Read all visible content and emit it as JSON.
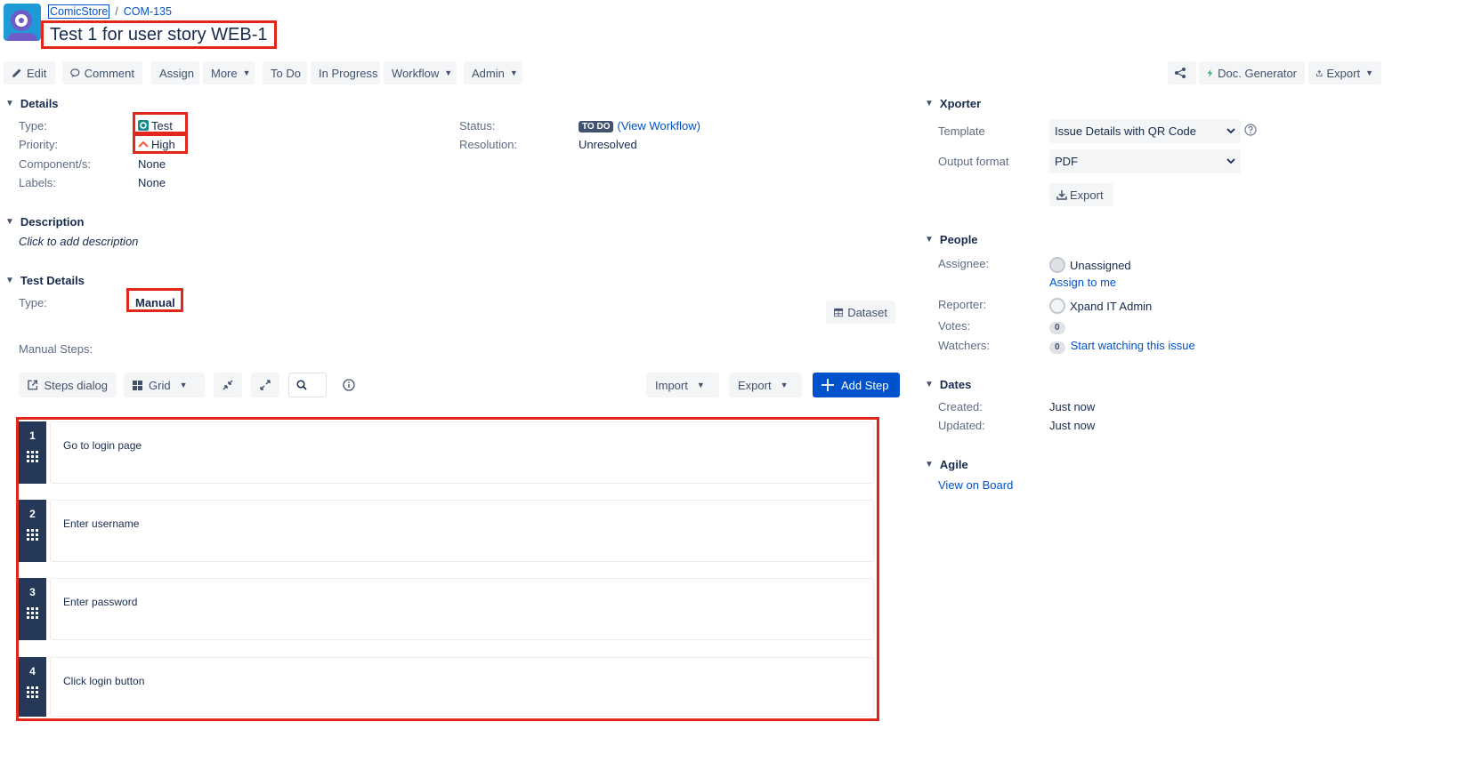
{
  "breadcrumb": {
    "project": "ComicStore",
    "separator": "/",
    "issue_key": "COM-135"
  },
  "issue_title": "Test 1 for user story WEB-1",
  "toolbar": {
    "edit": "Edit",
    "comment": "Comment",
    "assign": "Assign",
    "more": "More",
    "todo": "To Do",
    "in_progress": "In Progress",
    "workflow": "Workflow",
    "admin": "Admin",
    "doc_generator": "Doc. Generator",
    "export": "Export"
  },
  "details": {
    "header": "Details",
    "type_label": "Type:",
    "type_value": "Test",
    "priority_label": "Priority:",
    "priority_value": "High",
    "components_label": "Component/s:",
    "components_value": "None",
    "labels_label": "Labels:",
    "labels_value": "None",
    "status_label": "Status:",
    "status_value": "TO DO",
    "view_workflow": "(View Workflow)",
    "resolution_label": "Resolution:",
    "resolution_value": "Unresolved"
  },
  "description": {
    "header": "Description",
    "placeholder": "Click to add description"
  },
  "test_details": {
    "header": "Test Details",
    "type_label": "Type:",
    "type_value": "Manual",
    "dataset": "Dataset",
    "manual_steps_label": "Manual Steps:"
  },
  "steps_toolbar": {
    "steps_dialog": "Steps dialog",
    "grid": "Grid",
    "import": "Import",
    "export": "Export",
    "add_step": "Add Step"
  },
  "steps": [
    {
      "number": "1",
      "action": "Go to login page"
    },
    {
      "number": "2",
      "action": "Enter username"
    },
    {
      "number": "3",
      "action": "Enter password"
    },
    {
      "number": "4",
      "action": "Click login button"
    }
  ],
  "xporter": {
    "header": "Xporter",
    "template_label": "Template",
    "template_value": "Issue Details with QR Code",
    "output_label": "Output format",
    "output_value": "PDF",
    "export_button": "Export"
  },
  "people": {
    "header": "People",
    "assignee_label": "Assignee:",
    "assignee_value": "Unassigned",
    "assign_to_me": "Assign to me",
    "reporter_label": "Reporter:",
    "reporter_value": "Xpand IT Admin",
    "votes_label": "Votes:",
    "votes_value": "0",
    "watchers_label": "Watchers:",
    "watchers_value": "0",
    "start_watching": "Start watching this issue"
  },
  "dates": {
    "header": "Dates",
    "created_label": "Created:",
    "created_value": "Just now",
    "updated_label": "Updated:",
    "updated_value": "Just now"
  },
  "agile": {
    "header": "Agile",
    "view_on_board": "View on Board"
  },
  "colors": {
    "accent": "#0052cc",
    "highlight": "#e0271a",
    "step_bar": "#253858",
    "button_bg": "#f4f5f7"
  }
}
